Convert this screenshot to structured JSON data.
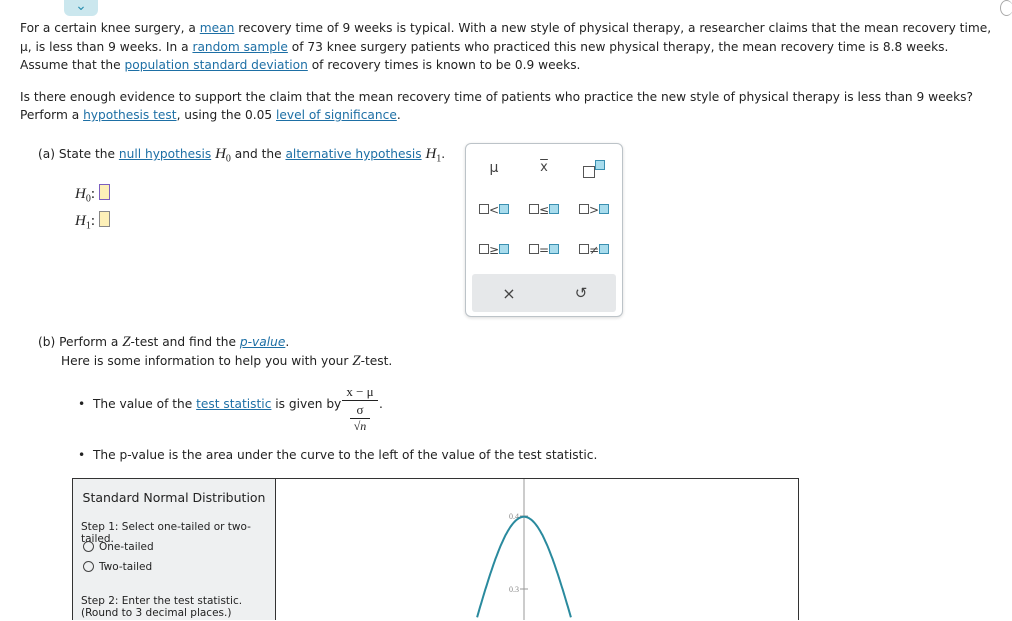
{
  "problem": {
    "p1_a": "For a certain knee surgery, a ",
    "mean": "mean",
    "p1_b": " recovery time of 9 weeks is typical. With a new style of physical therapy, a researcher claims that the mean recovery time,",
    "p1_c": "μ, is less than 9 weeks. In a ",
    "random_sample": "random sample",
    "p1_d": " of 73 knee surgery patients who practiced this new physical therapy, the mean recovery time is 8.8 weeks.",
    "p1_e": "Assume that the ",
    "pop_sd": "population standard deviation",
    "p1_f": " of recovery times is known to be 0.9 weeks.",
    "p2_a": "Is there enough evidence to support the claim that the mean recovery time of patients who practice the new style of physical therapy is less than 9 weeks?",
    "p2_b": "Perform a ",
    "hyp_test": "hypothesis test",
    "p2_c": ", using the 0.05 ",
    "level_sig": "level of significance",
    "p2_d": "."
  },
  "part_a": {
    "label": "(a) State the ",
    "null": "null hypothesis",
    "h0": "H",
    "mid": " and the ",
    "alt": "alternative hypothesis",
    "end": ".",
    "h0_label": "H",
    "h1_label": "H",
    "sub0": "0",
    "sub1": "1"
  },
  "palette": {
    "row1": [
      "μ",
      "x̄",
      "□^□"
    ],
    "row2": [
      "□<□",
      "□≤□",
      "□>□"
    ],
    "row3": [
      "□≥□",
      "□=□",
      "□≠□"
    ],
    "clear": "×",
    "undo": "↺"
  },
  "part_b": {
    "l1a": "(b) Perform a ",
    "Z": "Z",
    "l1b": "-test and find the ",
    "pvalue": "p-value",
    "l1c": ".",
    "l2a": "Here is some information to help you with your ",
    "l2b": "-test.",
    "b1a": "The value of the ",
    "test_stat": "test statistic",
    "b1b": " is given by ",
    "num": "x − μ",
    "den": "σ",
    "n": "n",
    "b2": "The p-value is the area under the curve to the left of the value of the test statistic."
  },
  "tool": {
    "title": "Standard Normal Distribution",
    "step1": "Step 1: Select one-tailed or two-tailed.",
    "opt1": "One-tailed",
    "opt2": "Two-tailed",
    "step2": "Step 2: Enter the test statistic.",
    "step2b": "(Round to 3 decimal places.)"
  },
  "chart_data": {
    "type": "line",
    "function": "standard normal density",
    "y_ticks": [
      0.3,
      0.4
    ],
    "curve_color": "#2a8a9e"
  }
}
